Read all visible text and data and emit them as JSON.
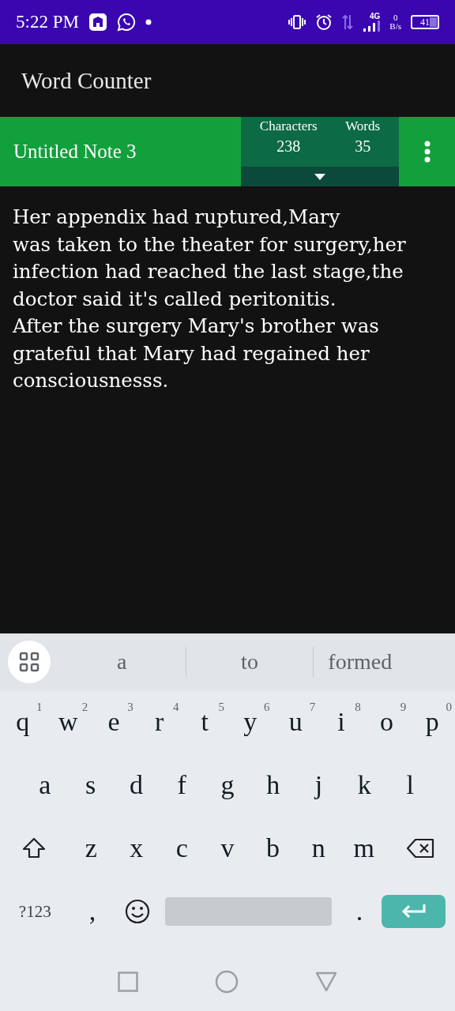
{
  "status_bar": {
    "time": "5:22 PM",
    "network": "4G",
    "speed_value": "0",
    "speed_unit": "B/s",
    "battery": "41"
  },
  "app_bar": {
    "title": "Word Counter"
  },
  "note_bar": {
    "title": "Untitled Note 3",
    "stats": [
      {
        "label": "Characters",
        "value": "238"
      },
      {
        "label": "Words",
        "value": "35"
      }
    ]
  },
  "editor": {
    "text": "Her appendix had ruptured,Mary\nwas taken to the theater for surgery,her infection had reached the last stage,the doctor said it's called peritonitis.\nAfter the surgery Mary's brother was grateful that Mary had regained her consciousnesss."
  },
  "keyboard": {
    "suggestions": [
      "a",
      "to",
      "formed"
    ],
    "letter_rows": [
      [
        {
          "kind": "letter",
          "label": "q",
          "hint": "1"
        },
        {
          "kind": "letter",
          "label": "w",
          "hint": "2"
        },
        {
          "kind": "letter",
          "label": "e",
          "hint": "3"
        },
        {
          "kind": "letter",
          "label": "r",
          "hint": "4"
        },
        {
          "kind": "letter",
          "label": "t",
          "hint": "5"
        },
        {
          "kind": "letter",
          "label": "y",
          "hint": "6"
        },
        {
          "kind": "letter",
          "label": "u",
          "hint": "7"
        },
        {
          "kind": "letter",
          "label": "i",
          "hint": "8"
        },
        {
          "kind": "letter",
          "label": "o",
          "hint": "9"
        },
        {
          "kind": "letter",
          "label": "p",
          "hint": "0"
        }
      ],
      [
        {
          "kind": "letter",
          "label": "a"
        },
        {
          "kind": "letter",
          "label": "s"
        },
        {
          "kind": "letter",
          "label": "d"
        },
        {
          "kind": "letter",
          "label": "f"
        },
        {
          "kind": "letter",
          "label": "g"
        },
        {
          "kind": "letter",
          "label": "h"
        },
        {
          "kind": "letter",
          "label": "j"
        },
        {
          "kind": "letter",
          "label": "k"
        },
        {
          "kind": "letter",
          "label": "l"
        }
      ],
      [
        {
          "kind": "shift"
        },
        {
          "kind": "letter",
          "label": "z"
        },
        {
          "kind": "letter",
          "label": "x"
        },
        {
          "kind": "letter",
          "label": "c"
        },
        {
          "kind": "letter",
          "label": "v"
        },
        {
          "kind": "letter",
          "label": "b"
        },
        {
          "kind": "letter",
          "label": "n"
        },
        {
          "kind": "letter",
          "label": "m"
        },
        {
          "kind": "backspace"
        }
      ]
    ],
    "bottom_row": [
      {
        "kind": "symbols",
        "label": "?123"
      },
      {
        "kind": "letter",
        "label": ","
      },
      {
        "kind": "emoji"
      },
      {
        "kind": "space"
      },
      {
        "kind": "letter",
        "label": "."
      },
      {
        "kind": "enter"
      }
    ]
  }
}
